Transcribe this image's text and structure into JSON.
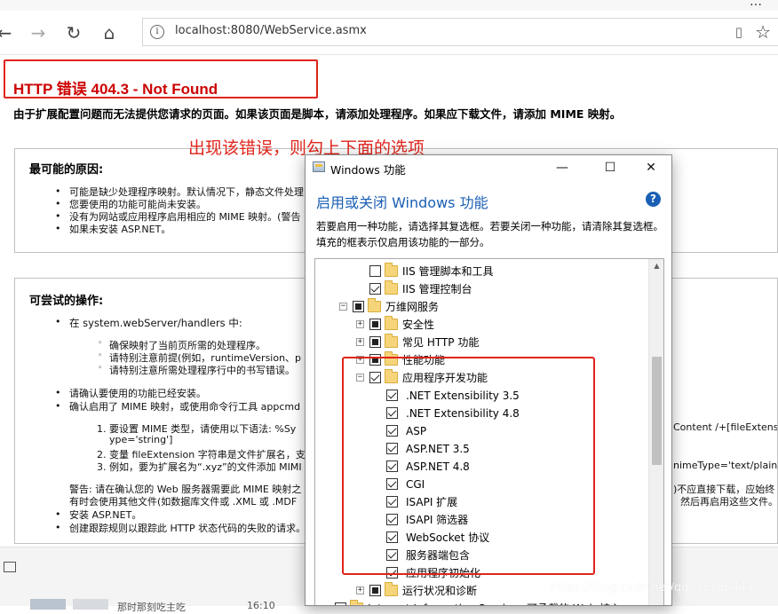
{
  "browser": {
    "url": "localhost:8080/WebService.asmx",
    "back_icon": "arrow-left-icon",
    "forward_icon": "arrow-right-icon",
    "refresh_icon": "refresh-icon",
    "home_icon": "home-icon",
    "menu_dots": "…"
  },
  "page": {
    "error_title": "HTTP 错误 404.3 - Not Found",
    "summary": "由于扩展配置问题而无法提供您请求的页面。如果该页面是脚本，请添加处理程序。如果应下载文件，请添加 MIME 映射。",
    "annotation": "出现该错误，则勾上下面的选项",
    "causes_title": "最可能的原因:",
    "causes": [
      "可能是缺少处理程序映射。默认情况下，静态文件处理",
      "您要使用的功能可能尚未安装。",
      "没有为网站或应用程序启用相应的 MIME 映射。(警告",
      "如果未安装 ASP.NET。"
    ],
    "actions_title": "可尝试的操作:",
    "actions": {
      "handlers": "在 system.webServer/handlers 中:",
      "handlers_sub": [
        "确保映射了当前页所需的处理程序。",
        "请特别注意前提(例如，runtimeVersion、p",
        "请特别注意所需处理程序行中的书写错误。"
      ],
      "verify_installed": "请确认要使用的功能已经安装。",
      "verify_mime": "确认启用了 MIME 映射，或使用命令行工具 appcmd",
      "steps": [
        "1.   要设置 MIME 类型，请使用以下语法: %Sy",
        "ype='string']",
        "2.   变量 fileExtension 字符串是文件扩展名，支",
        "3.   例如，要为扩展名为“.xyz”的文件添加 MIMI"
      ],
      "right_1": "Content /+[fileExtens",
      "right_2": "nimeType='text/plain",
      "warning_1": "警告: 请在确认您的 Web 服务器需要此 MIME 映射之",
      "warning_2": "有时会使用其他文件(如数据库文件或 .XML 或 .MDF",
      "warning_right_1": ")不应直接下载，应始终",
      "warning_right_2": "然后再启用这些文件。",
      "install_aspnet": "安装 ASP.NET。",
      "trace": "创建跟踪规则以跟踪此 HTTP 状态代码的失败的请求。"
    }
  },
  "taskbar": {
    "item_1": "那时那刻吃主吃",
    "time": "16:10"
  },
  "dialog": {
    "title": "Windows 功能",
    "heading": "启用或关闭 Windows 功能",
    "help": "?",
    "description": "若要启用一种功能，请选择其复选框。若要关闭一种功能，请清除其复选框。填充的框表示仅启用该功能的一部分。",
    "minimize": "—",
    "maximize": "☐",
    "close": "✕",
    "items": [
      {
        "label": "IIS 管理脚本和工具",
        "state": "unchecked",
        "expand": ""
      },
      {
        "label": "IIS 管理控制台",
        "state": "checked",
        "expand": ""
      },
      {
        "label": "万维网服务",
        "state": "partial",
        "expand": "−"
      },
      {
        "label": "安全性",
        "state": "partial",
        "expand": "+"
      },
      {
        "label": "常见 HTTP 功能",
        "state": "partial",
        "expand": "+"
      },
      {
        "label": "性能功能",
        "state": "partial",
        "expand": "+"
      },
      {
        "label": "应用程序开发功能",
        "state": "checked",
        "expand": "−"
      },
      {
        "label": ".NET Extensibility 3.5",
        "state": "checked",
        "expand": ""
      },
      {
        "label": ".NET Extensibility 4.8",
        "state": "checked",
        "expand": ""
      },
      {
        "label": "ASP",
        "state": "checked",
        "expand": ""
      },
      {
        "label": "ASP.NET 3.5",
        "state": "checked",
        "expand": ""
      },
      {
        "label": "ASP.NET 4.8",
        "state": "checked",
        "expand": ""
      },
      {
        "label": "CGI",
        "state": "checked",
        "expand": ""
      },
      {
        "label": "ISAPI 扩展",
        "state": "checked",
        "expand": ""
      },
      {
        "label": "ISAPI 筛选器",
        "state": "checked",
        "expand": ""
      },
      {
        "label": "WebSocket 协议",
        "state": "checked",
        "expand": ""
      },
      {
        "label": "服务器端包含",
        "state": "checked",
        "expand": ""
      },
      {
        "label": "应用程序初始化",
        "state": "checked",
        "expand": ""
      },
      {
        "label": "运行状况和诊断",
        "state": "partial",
        "expand": "+"
      },
      {
        "label": "Internet Information Services 可承载的 Web 核心",
        "state": "unchecked",
        "expand": ""
      }
    ]
  },
  "watermark": "https://blog.csdn.net/qq_43786444"
}
